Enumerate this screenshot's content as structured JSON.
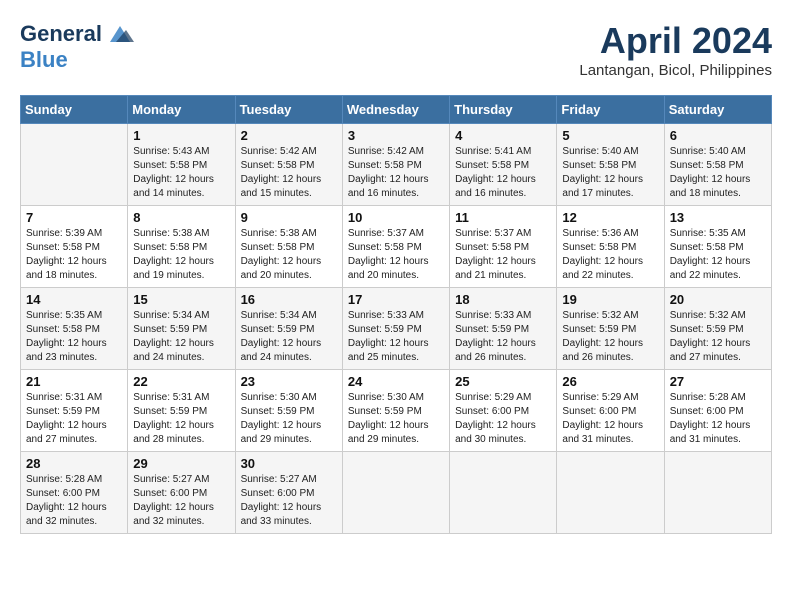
{
  "header": {
    "logo_line1": "General",
    "logo_line2": "Blue",
    "month": "April 2024",
    "location": "Lantangan, Bicol, Philippines"
  },
  "days_of_week": [
    "Sunday",
    "Monday",
    "Tuesday",
    "Wednesday",
    "Thursday",
    "Friday",
    "Saturday"
  ],
  "weeks": [
    [
      {
        "day": "",
        "info": ""
      },
      {
        "day": "1",
        "info": "Sunrise: 5:43 AM\nSunset: 5:58 PM\nDaylight: 12 hours\nand 14 minutes."
      },
      {
        "day": "2",
        "info": "Sunrise: 5:42 AM\nSunset: 5:58 PM\nDaylight: 12 hours\nand 15 minutes."
      },
      {
        "day": "3",
        "info": "Sunrise: 5:42 AM\nSunset: 5:58 PM\nDaylight: 12 hours\nand 16 minutes."
      },
      {
        "day": "4",
        "info": "Sunrise: 5:41 AM\nSunset: 5:58 PM\nDaylight: 12 hours\nand 16 minutes."
      },
      {
        "day": "5",
        "info": "Sunrise: 5:40 AM\nSunset: 5:58 PM\nDaylight: 12 hours\nand 17 minutes."
      },
      {
        "day": "6",
        "info": "Sunrise: 5:40 AM\nSunset: 5:58 PM\nDaylight: 12 hours\nand 18 minutes."
      }
    ],
    [
      {
        "day": "7",
        "info": "Sunrise: 5:39 AM\nSunset: 5:58 PM\nDaylight: 12 hours\nand 18 minutes."
      },
      {
        "day": "8",
        "info": "Sunrise: 5:38 AM\nSunset: 5:58 PM\nDaylight: 12 hours\nand 19 minutes."
      },
      {
        "day": "9",
        "info": "Sunrise: 5:38 AM\nSunset: 5:58 PM\nDaylight: 12 hours\nand 20 minutes."
      },
      {
        "day": "10",
        "info": "Sunrise: 5:37 AM\nSunset: 5:58 PM\nDaylight: 12 hours\nand 20 minutes."
      },
      {
        "day": "11",
        "info": "Sunrise: 5:37 AM\nSunset: 5:58 PM\nDaylight: 12 hours\nand 21 minutes."
      },
      {
        "day": "12",
        "info": "Sunrise: 5:36 AM\nSunset: 5:58 PM\nDaylight: 12 hours\nand 22 minutes."
      },
      {
        "day": "13",
        "info": "Sunrise: 5:35 AM\nSunset: 5:58 PM\nDaylight: 12 hours\nand 22 minutes."
      }
    ],
    [
      {
        "day": "14",
        "info": "Sunrise: 5:35 AM\nSunset: 5:58 PM\nDaylight: 12 hours\nand 23 minutes."
      },
      {
        "day": "15",
        "info": "Sunrise: 5:34 AM\nSunset: 5:59 PM\nDaylight: 12 hours\nand 24 minutes."
      },
      {
        "day": "16",
        "info": "Sunrise: 5:34 AM\nSunset: 5:59 PM\nDaylight: 12 hours\nand 24 minutes."
      },
      {
        "day": "17",
        "info": "Sunrise: 5:33 AM\nSunset: 5:59 PM\nDaylight: 12 hours\nand 25 minutes."
      },
      {
        "day": "18",
        "info": "Sunrise: 5:33 AM\nSunset: 5:59 PM\nDaylight: 12 hours\nand 26 minutes."
      },
      {
        "day": "19",
        "info": "Sunrise: 5:32 AM\nSunset: 5:59 PM\nDaylight: 12 hours\nand 26 minutes."
      },
      {
        "day": "20",
        "info": "Sunrise: 5:32 AM\nSunset: 5:59 PM\nDaylight: 12 hours\nand 27 minutes."
      }
    ],
    [
      {
        "day": "21",
        "info": "Sunrise: 5:31 AM\nSunset: 5:59 PM\nDaylight: 12 hours\nand 27 minutes."
      },
      {
        "day": "22",
        "info": "Sunrise: 5:31 AM\nSunset: 5:59 PM\nDaylight: 12 hours\nand 28 minutes."
      },
      {
        "day": "23",
        "info": "Sunrise: 5:30 AM\nSunset: 5:59 PM\nDaylight: 12 hours\nand 29 minutes."
      },
      {
        "day": "24",
        "info": "Sunrise: 5:30 AM\nSunset: 5:59 PM\nDaylight: 12 hours\nand 29 minutes."
      },
      {
        "day": "25",
        "info": "Sunrise: 5:29 AM\nSunset: 6:00 PM\nDaylight: 12 hours\nand 30 minutes."
      },
      {
        "day": "26",
        "info": "Sunrise: 5:29 AM\nSunset: 6:00 PM\nDaylight: 12 hours\nand 31 minutes."
      },
      {
        "day": "27",
        "info": "Sunrise: 5:28 AM\nSunset: 6:00 PM\nDaylight: 12 hours\nand 31 minutes."
      }
    ],
    [
      {
        "day": "28",
        "info": "Sunrise: 5:28 AM\nSunset: 6:00 PM\nDaylight: 12 hours\nand 32 minutes."
      },
      {
        "day": "29",
        "info": "Sunrise: 5:27 AM\nSunset: 6:00 PM\nDaylight: 12 hours\nand 32 minutes."
      },
      {
        "day": "30",
        "info": "Sunrise: 5:27 AM\nSunset: 6:00 PM\nDaylight: 12 hours\nand 33 minutes."
      },
      {
        "day": "",
        "info": ""
      },
      {
        "day": "",
        "info": ""
      },
      {
        "day": "",
        "info": ""
      },
      {
        "day": "",
        "info": ""
      }
    ]
  ]
}
